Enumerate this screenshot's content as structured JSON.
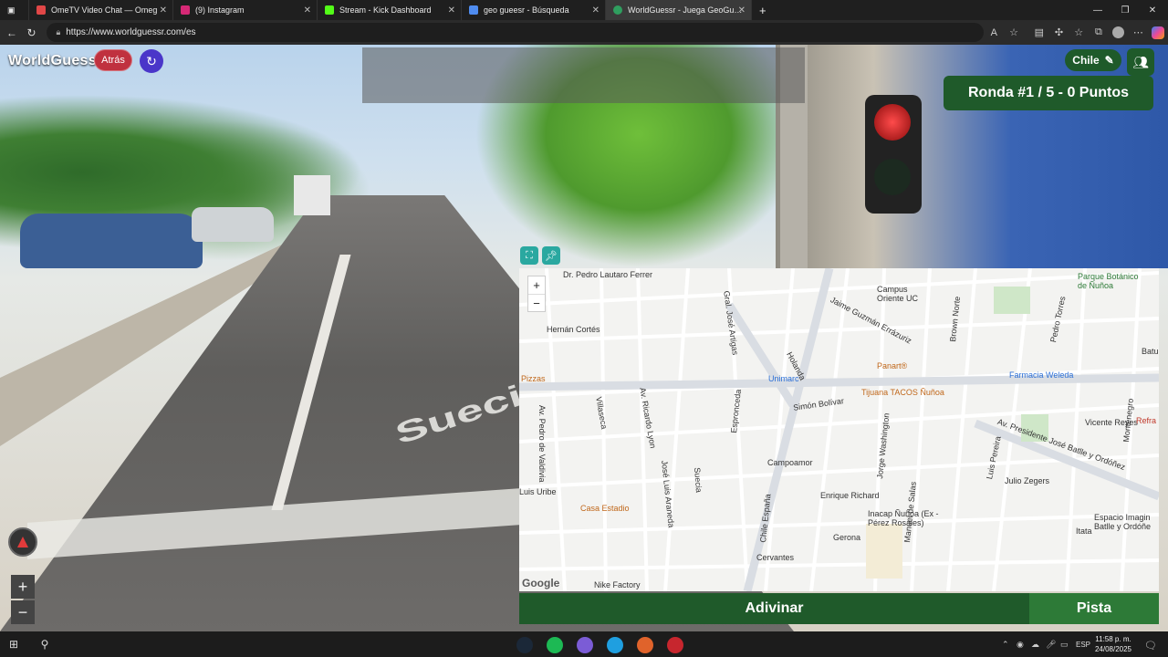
{
  "browser": {
    "tabs": [
      {
        "label": "OmeTV Video Chat — Omeg",
        "favicon_color": "#e14747"
      },
      {
        "label": "(9) Instagram",
        "favicon_color": "#d62976"
      },
      {
        "label": "Stream - Kick Dashboard",
        "favicon_color": "#53fc18"
      },
      {
        "label": "geo gueesr - Búsqueda",
        "favicon_color": "#4f8cf0"
      },
      {
        "label": "WorldGuessr - Juega GeoGuessr",
        "favicon_color": "#2f9e5f"
      }
    ],
    "url": "https://www.worldguessr.com/es"
  },
  "game": {
    "logo": "WorldGuessr",
    "back_label": "Atrás",
    "country_label": "Chile",
    "round_banner": "Ronda #1 / 5 - 0 Puntos",
    "street_paint": "Suecia",
    "guess_label": "Adivinar",
    "hint_label": "Pista"
  },
  "map": {
    "zoom_in": "+",
    "zoom_out": "−",
    "google": "Google",
    "labels": [
      "Dr. Pedro Lautaro Ferrer",
      "Campus Oriente UC",
      "Parque Botánico de Ñuñoa",
      "Jaime Guzmán Errázuriz",
      "Hernán Cortés",
      "Pizzas",
      "Unimarc",
      "Panart®",
      "Farmacia Weleda",
      "Tijuana TACOS Ñuñoa",
      "Simón Bolívar",
      "Vicente Reyes",
      "Av. Presidente José Batlle y Ordóñez",
      "Campoamor",
      "Julio Zegers",
      "Luis Uribe",
      "Enrique Richard",
      "Casa Estadio",
      "Inacap Ñuñoa (Ex - Pérez Rosales)",
      "Gerona",
      "Espacio Imagin Batlle y Ordóñe",
      "Cervantes",
      "Nike Factory",
      "Av. Pedro de Valdivia",
      "Av. Ricardo Lyon",
      "Villaseca",
      "José Luis Araneda",
      "Suecia",
      "Espronceda",
      "Chile España",
      "Holanda",
      "Gral. José Artigas",
      "Jorge Washington",
      "Manuel de Salas",
      "Brown Norte",
      "Luis Pereira",
      "Pedro Torres",
      "Montenegro",
      "Itata",
      "Batu",
      "Refra"
    ]
  },
  "taskbar": {
    "lang": "ESP",
    "time": "11:58 p. m.",
    "date": "24/08/2025"
  }
}
